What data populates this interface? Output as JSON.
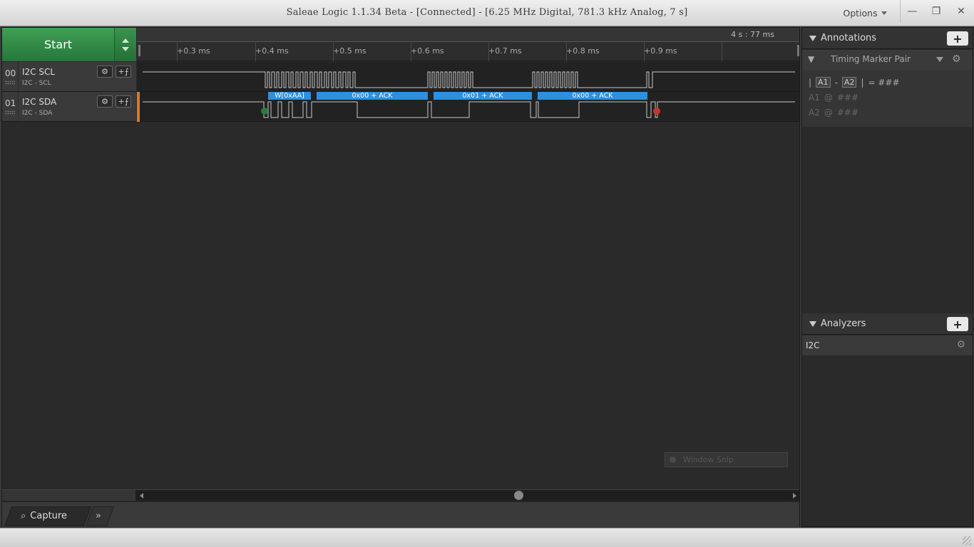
{
  "window": {
    "title": "Saleae Logic 1.1.34 Beta - [Connected] - [6.25 MHz Digital, 781.3 kHz Analog, 7 s]",
    "options_label": "Options",
    "minimize": "—",
    "maximize": "❐",
    "close": "✕"
  },
  "capture": {
    "start_label": "Start",
    "time_readout": "4 s : 77 ms",
    "ticks": [
      "+0.3 ms",
      "+0.4 ms",
      "+0.5 ms",
      "+0.6 ms",
      "+0.7 ms",
      "+0.8 ms",
      "+0.9 ms"
    ]
  },
  "channels": [
    {
      "num": "00",
      "name": "I2C SCL",
      "sub": "I2C - SCL"
    },
    {
      "num": "01",
      "name": "I2C SDA",
      "sub": "I2C - SDA"
    }
  ],
  "decoded": [
    {
      "label": "W[0xAA]"
    },
    {
      "label": "0x00 + ACK"
    },
    {
      "label": "0x01 + ACK"
    },
    {
      "label": "0x00 + ACK"
    }
  ],
  "window_snip": "Window Snip",
  "bottom": {
    "capture_tab": "Capture",
    "expand": "»"
  },
  "annotations": {
    "header": "Annotations",
    "plus": "+",
    "marker_type": "Timing Marker Pair",
    "line1_a1": "A1",
    "line1_a2": "A2",
    "line1_value": "= ###",
    "line2_name": "A1",
    "line2_at": "@",
    "line2_value": "###",
    "line3_name": "A2",
    "line3_at": "@",
    "line3_value": "###"
  },
  "analyzers": {
    "header": "Analyzers",
    "plus": "+",
    "items": [
      {
        "label": "I2C"
      }
    ]
  },
  "colors": {
    "start_green": "#3fa054",
    "decoded_blue": "#2e8fe0",
    "start_marker": "#2d7a3e",
    "stop_marker": "#c0392b",
    "accent_orange": "#d77a2a"
  }
}
